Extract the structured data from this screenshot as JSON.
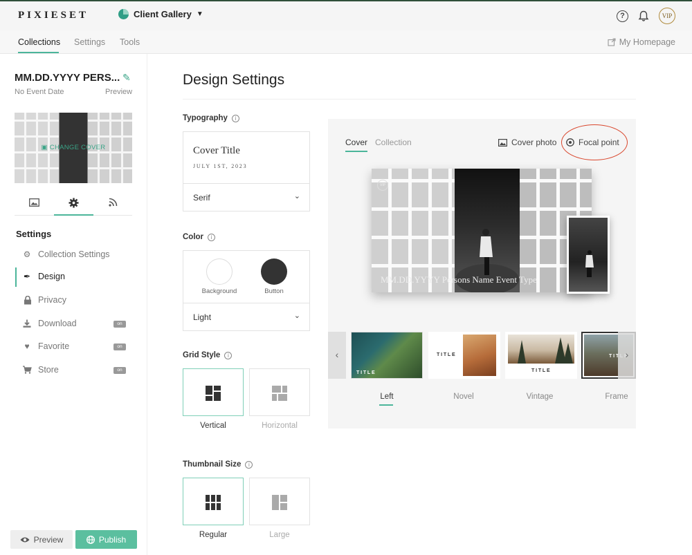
{
  "app": {
    "logo": "PIXIESET",
    "product": "Client Gallery",
    "vip": "VIP",
    "help": "?"
  },
  "nav": {
    "tabs": [
      "Collections",
      "Settings",
      "Tools"
    ],
    "my_homepage": "My Homepage"
  },
  "gallery": {
    "title": "MM.DD.YYYY PERS...",
    "event_date": "No Event Date",
    "preview": "Preview",
    "change_cover": "CHANGE COVER"
  },
  "sidebar": {
    "settings_heading": "Settings",
    "items": [
      {
        "label": "Collection Settings",
        "icon": "gear-icon",
        "badge": ""
      },
      {
        "label": "Design",
        "icon": "brush-icon",
        "badge": ""
      },
      {
        "label": "Privacy",
        "icon": "lock-icon",
        "badge": ""
      },
      {
        "label": "Download",
        "icon": "download-icon",
        "badge": "on"
      },
      {
        "label": "Favorite",
        "icon": "heart-icon",
        "badge": "on"
      },
      {
        "label": "Store",
        "icon": "cart-icon",
        "badge": "on"
      }
    ],
    "preview_button": "Preview",
    "publish_button": "Publish"
  },
  "design": {
    "title": "Design Settings",
    "typography": {
      "heading": "Typography",
      "cover_title": "Cover Title",
      "cover_date": "JULY 1ST, 2023",
      "font": "Serif"
    },
    "color": {
      "heading": "Color",
      "background_label": "Background",
      "button_label": "Button",
      "background_color": "#ffffff",
      "button_color": "#333333",
      "theme": "Light"
    },
    "grid_style": {
      "heading": "Grid Style",
      "options": [
        "Vertical",
        "Horizontal"
      ]
    },
    "thumbnail_size": {
      "heading": "Thumbnail Size",
      "options": [
        "Regular",
        "Large"
      ]
    }
  },
  "preview": {
    "tabs": [
      "Cover",
      "Collection"
    ],
    "cover_photo": "Cover photo",
    "focal_point": "Focal point",
    "cover_caption": "MM.DD.YYYY Persons Name Event Type",
    "cover_vip": "VIP",
    "layouts": [
      {
        "label": "Left",
        "title": "TITLE"
      },
      {
        "label": "Novel",
        "title": "TITLE"
      },
      {
        "label": "Vintage",
        "title": "TITLE"
      },
      {
        "label": "Frame",
        "title": "TITLE"
      }
    ],
    "accent_color": "#4bb59a",
    "highlight_color": "#d9462c"
  }
}
